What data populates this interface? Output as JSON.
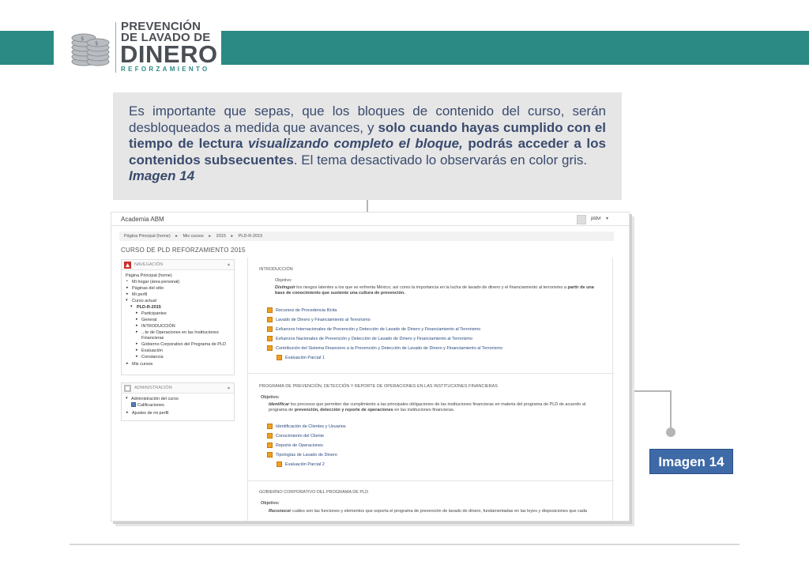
{
  "logo": {
    "line1": "PREVENCIÓN",
    "line2": "DE LAVADO DE",
    "line3": "DINERO",
    "line4": "REFORZAMIENTO"
  },
  "colors": {
    "teal": "#2c8a85",
    "info_text": "#3a4b6e",
    "label_bg": "#3f6aa8"
  },
  "info": {
    "t1": "Es importante que sepas, que los bloques de contenido del curso, serán desbloqueados a medida que avances, y ",
    "t2": "solo cuando hayas cumplido con el tiempo de lectura ",
    "t3": "visualizando completo el bloque,",
    "t4": " podrás acceder a los contenidos subsecuentes",
    "t5": ". El tema desactivado lo observarás en color gris.",
    "ref": "Imagen 14"
  },
  "image_label": "Imagen 14",
  "screenshot": {
    "site_name": "Academia ABM",
    "user_name": "pldvr",
    "breadcrumb": [
      "Página Principal (home)",
      "▸",
      "Mis cursos",
      "▸",
      "2015",
      "▸",
      "PLD-R-2015"
    ],
    "course_title": "CURSO DE PLD REFORZAMIENTO 2015",
    "nav": {
      "title": "NAVEGACIÓN",
      "items": [
        "Página Principal (home)",
        "Mi hogar (área personal)",
        "Páginas del sitio",
        "Mi perfil",
        "Curso actual",
        "PLD-R-2015",
        "Participantes",
        "General",
        "INTRODUCCIÓN",
        "...te de Operaciones en las Instituciones",
        "Financieras",
        "Gobierno Corporativo del Programa de PLD",
        "Evaluación",
        "Constancia",
        "Mis cursos"
      ]
    },
    "admin": {
      "title": "ADMINISTRACIÓN",
      "items": [
        "Administración del curso",
        "Calificaciones",
        "Ajustes de mi perfil"
      ]
    },
    "sections": [
      {
        "title": "INTRODUCCIÓN",
        "objective_label": "Objetivo:",
        "para_a": "Distinguir",
        "para_b": " los riesgos latentes a los que se enfrenta México, así como la importancia en la lucha de lavado de dinero y el financiamiento al terrorismo a ",
        "para_c": "partir de una base de conocimiento que sustente una cultura de prevención.",
        "activities": [
          "Recursos de Procedencia Ilícita",
          "Lavado de Dinero y Financiamiento al Terrorismo",
          "Esfuerzos Internacionales de Prevención y Detección de Lavado de Dinero y Financiamiento al Terrorismo",
          "Esfuerzos Nacionales de Prevención y Detección de Lavado de Dinero y Financiamiento al Terrorismo",
          "Contribución del Sistema Financiero a la Prevención y Detección de Lavado de Dinero y Financiamiento al Terrorismo",
          "Evaluación Parcial 1"
        ]
      },
      {
        "title": "PROGRAMA DE PREVENCIÓN, DETECCIÓN Y REPORTE DE OPERACIONES EN LAS INSTITUCIONES FINANCIERAS",
        "objective_label": "Objetivo:",
        "para_a": "Identificar",
        "para_b": " los procesos que permiten dar cumplimiento a las principales obligaciones de las instituciones financieras en materia del programa de PLD de acuerdo al programa de ",
        "para_c": "prevención, detección y reporte de operaciones",
        "para_d": " en las instituciones financieras.",
        "activities": [
          "Identificación de Clientes y Usuarios",
          "Conocimiento del Cliente",
          "Reporte de Operaciones",
          "Tipologías de Lavado de Dinero",
          "Evaluación Parcial 2"
        ]
      },
      {
        "title": "GOBIERNO CORPORATIVO DEL PROGRAMA DE PLD",
        "objective_label": "Objetivo:",
        "para_a": "Reconocer",
        "para_b": " cuáles son las funciones y elementos que soporta el programa de prevención de lavado de dinero, fundamentadas en las leyes y disposiciones que cada"
      }
    ]
  }
}
